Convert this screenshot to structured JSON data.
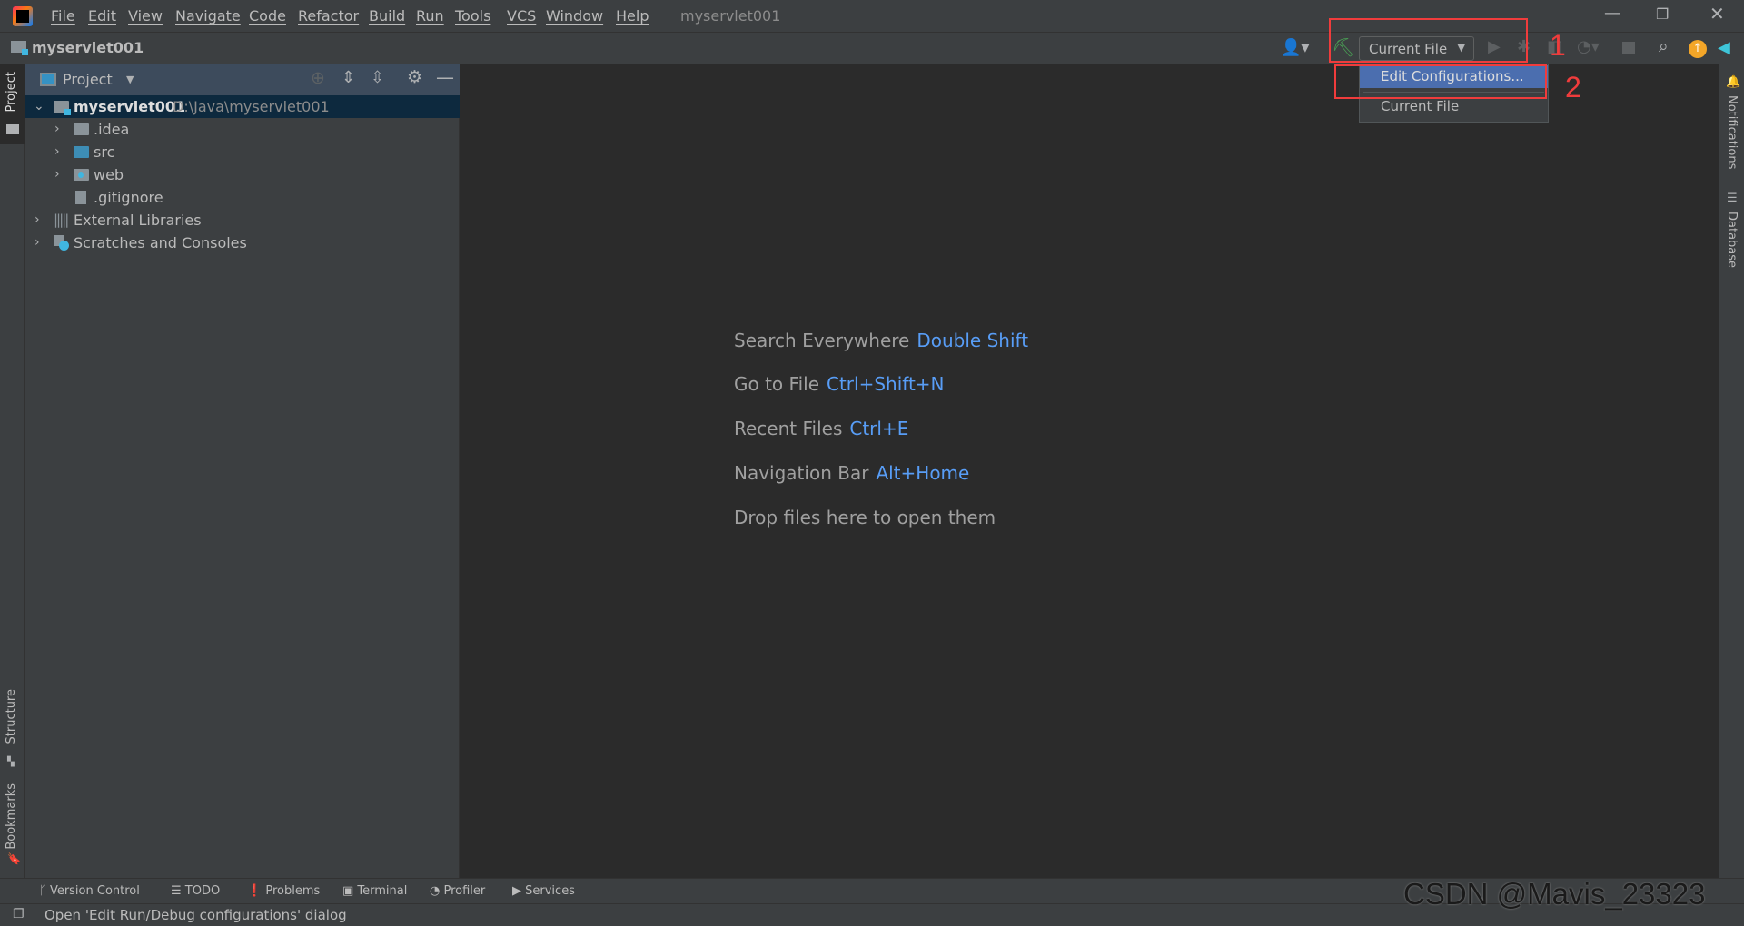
{
  "menubar": {
    "items": [
      "File",
      "Edit",
      "View",
      "Navigate",
      "Code",
      "Refactor",
      "Build",
      "Run",
      "Tools",
      "VCS",
      "Window",
      "Help"
    ],
    "project_title": "myservlet001"
  },
  "toolbar": {
    "project_name": "myservlet001",
    "run_config": "Current File"
  },
  "run_config_menu": {
    "items": [
      "Edit Configurations...",
      "Current File"
    ],
    "selected": "Edit Configurations..."
  },
  "annotations": {
    "step1": "1",
    "step2": "2"
  },
  "left_strip": {
    "project": "Project",
    "structure": "Structure",
    "bookmarks": "Bookmarks"
  },
  "right_strip": {
    "notifications": "Notifications",
    "database": "Database"
  },
  "project_panel": {
    "title": "Project",
    "root": {
      "name": "myservlet001",
      "path": "D:\\Java\\myservlet001"
    },
    "children": [
      ".idea",
      "src",
      "web",
      ".gitignore"
    ],
    "external": "External Libraries",
    "scratches": "Scratches and Consoles"
  },
  "editor_hints": [
    {
      "label": "Search Everywhere",
      "key": "Double Shift"
    },
    {
      "label": "Go to File",
      "key": "Ctrl+Shift+N"
    },
    {
      "label": "Recent Files",
      "key": "Ctrl+E"
    },
    {
      "label": "Navigation Bar",
      "key": "Alt+Home"
    },
    {
      "label": "Drop files here to open them",
      "key": ""
    }
  ],
  "bottom_tools": [
    "Version Control",
    "TODO",
    "Problems",
    "Terminal",
    "Profiler",
    "Services"
  ],
  "status": {
    "message": "Open 'Edit Run/Debug configurations' dialog"
  },
  "watermark": "CSDN @Mavis_23323",
  "colors": {
    "accent": "#4b6eaf",
    "link": "#589df6",
    "annotation": "#f03c3c"
  }
}
